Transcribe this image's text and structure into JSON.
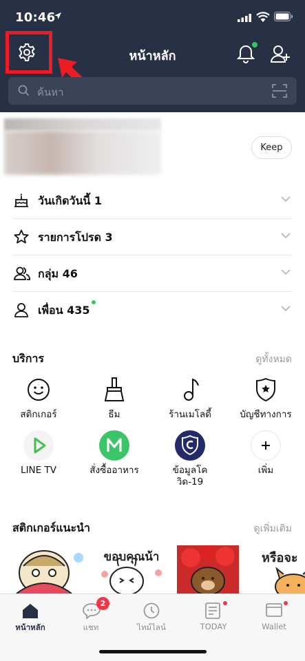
{
  "status_bar": {
    "time": "10:46"
  },
  "header": {
    "title": "หน้าหลัก",
    "search_placeholder": "ค้นหา"
  },
  "profile": {
    "keep_label": "Keep"
  },
  "list": [
    {
      "label": "วันเกิดวันนี้ 1",
      "icon": "cake-icon"
    },
    {
      "label": "รายการโปรด 3",
      "icon": "star-icon"
    },
    {
      "label": "กลุ่ม 46",
      "icon": "group-icon"
    },
    {
      "label": "เพื่อน 435",
      "icon": "friend-icon"
    }
  ],
  "services": {
    "title": "บริการ",
    "see_all": "ดูทั้งหมด",
    "items": [
      {
        "label": "สติกเกอร์",
        "icon": "smiley-icon"
      },
      {
        "label": "ธีม",
        "icon": "brush-icon"
      },
      {
        "label": "ร้านเมโลดี้",
        "icon": "music-note-icon"
      },
      {
        "label": "บัญชีทางการ",
        "icon": "badge-star-icon"
      },
      {
        "label": "LINE TV",
        "icon": "play-icon",
        "color": "#45c04c"
      },
      {
        "label": "สั่งซื้ออาหาร",
        "icon": "line-man-icon",
        "color": "#3bc468"
      },
      {
        "label": "ข้อมูลโค",
        "label2": "วิด-19",
        "icon": "covid-shield-icon",
        "color": "#232a6b"
      },
      {
        "label": "เพิ่ม",
        "icon": "plus-icon"
      }
    ]
  },
  "stickers": {
    "title": "สติกเกอร์แนะนำ",
    "see_more": "ดูเพิ่มเติม",
    "items": [
      {
        "icon": "sticker-baby-icon"
      },
      {
        "icon": "sticker-rabbit-icon",
        "text": "ขอบคุณน้า"
      },
      {
        "icon": "sticker-bear-icon"
      },
      {
        "icon": "sticker-cat-icon",
        "text": "หรือจะ"
      }
    ]
  },
  "nav": {
    "tabs": [
      {
        "label": "หน้าหลัก",
        "icon": "home-icon",
        "active": true
      },
      {
        "label": "แชท",
        "icon": "chat-icon",
        "badge": "2"
      },
      {
        "label": "ไทม์ไลน์",
        "icon": "clock-icon"
      },
      {
        "label": "TODAY",
        "icon": "news-icon"
      },
      {
        "label": "Wallet",
        "icon": "wallet-icon"
      }
    ]
  },
  "colors": {
    "header_bg": "#283046",
    "highlight": "#ec1b24",
    "green_dot": "#35c759",
    "badge_red": "#f33548"
  }
}
